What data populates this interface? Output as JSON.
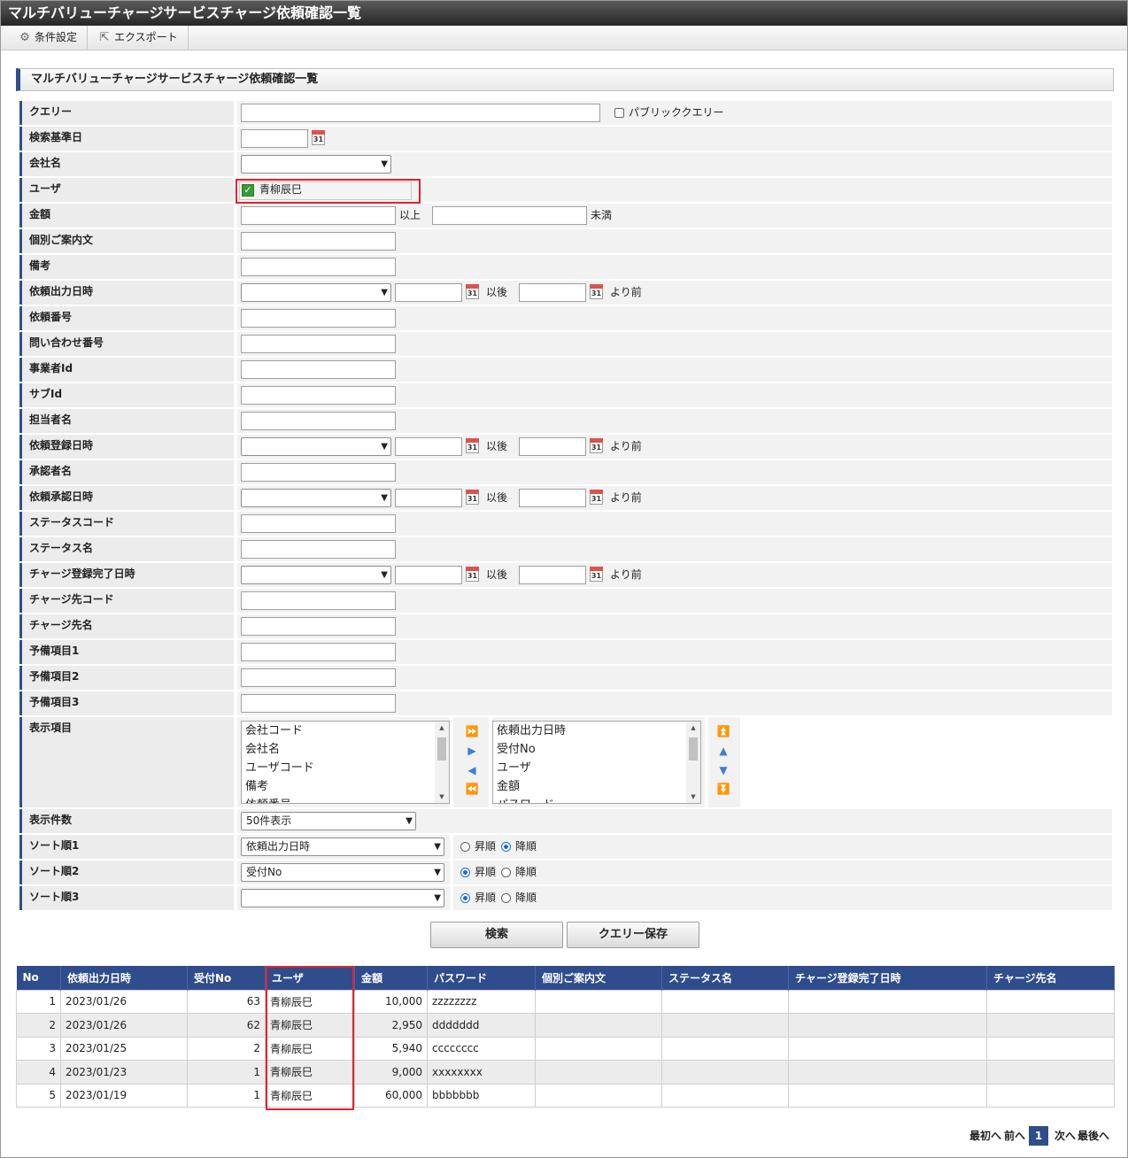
{
  "window": {
    "title": "マルチバリューチャージサービスチャージ依頼確認一覧"
  },
  "toolbar": {
    "settings_label": "条件設定",
    "export_label": "エクスポート"
  },
  "section": {
    "title": "マルチバリューチャージサービスチャージ依頼確認一覧"
  },
  "form": {
    "query_label": "クエリー",
    "public_query_label": "パブリッククエリー",
    "base_date_label": "検索基準日",
    "company_label": "会社名",
    "user_label": "ユーザ",
    "user_value": "青柳辰巳",
    "amount_label": "金額",
    "amount_min_suffix": "以上",
    "amount_max_suffix": "未満",
    "message_label": "個別ご案内文",
    "note_label": "備考",
    "req_output_label": "依頼出力日時",
    "req_no_label": "依頼番号",
    "inquiry_no_label": "問い合わせ番号",
    "business_id_label": "事業者Id",
    "sub_id_label": "サブId",
    "staff_label": "担当者名",
    "req_reg_label": "依頼登録日時",
    "approver_label": "承認者名",
    "req_approve_label": "依頼承認日時",
    "status_code_label": "ステータスコード",
    "status_name_label": "ステータス名",
    "charge_done_label": "チャージ登録完了日時",
    "charge_to_code_label": "チャージ先コード",
    "charge_to_name_label": "チャージ先名",
    "spare1_label": "予備項目1",
    "spare2_label": "予備項目2",
    "spare3_label": "予備項目3",
    "display_items_label": "表示項目",
    "available_items": [
      "会社コード",
      "会社名",
      "ユーザコード",
      "備考",
      "依頼番号"
    ],
    "selected_items": [
      "依頼出力日時",
      "受付No",
      "ユーザ",
      "金額",
      "パスワード"
    ],
    "page_size_label": "表示件数",
    "page_size_value": "50件表示",
    "sort1_label": "ソート順1",
    "sort1_value": "依頼出力日時",
    "sort2_label": "ソート順2",
    "sort2_value": "受付No",
    "sort3_label": "ソート順3",
    "sort3_value": "",
    "asc_label": "昇順",
    "desc_label": "降順",
    "after_label": "以後",
    "before_label": "より前",
    "cal_label": "31"
  },
  "actions": {
    "search_label": "検索",
    "save_query_label": "クエリー保存"
  },
  "table": {
    "headers": [
      "No",
      "依頼出力日時",
      "受付No",
      "ユーザ",
      "金額",
      "パスワード",
      "個別ご案内文",
      "ステータス名",
      "チャージ登録完了日時",
      "チャージ先名"
    ],
    "rows": [
      [
        "1",
        "2023/01/26",
        "63",
        "青柳辰巳",
        "10,000",
        "zzzzzzzz",
        "",
        "",
        "",
        ""
      ],
      [
        "2",
        "2023/01/26",
        "62",
        "青柳辰巳",
        "2,950",
        "ddddddd",
        "",
        "",
        "",
        ""
      ],
      [
        "3",
        "2023/01/25",
        "2",
        "青柳辰巳",
        "5,940",
        "cccccccc",
        "",
        "",
        "",
        ""
      ],
      [
        "4",
        "2023/01/23",
        "1",
        "青柳辰巳",
        "9,000",
        "xxxxxxxx",
        "",
        "",
        "",
        ""
      ],
      [
        "5",
        "2023/01/19",
        "1",
        "青柳辰巳",
        "60,000",
        "bbbbbbb",
        "",
        "",
        "",
        ""
      ]
    ]
  },
  "pager": {
    "first_label": "最初へ",
    "prev_label": "前へ",
    "current": "1",
    "next_label": "次へ",
    "last_label": "最後へ"
  }
}
